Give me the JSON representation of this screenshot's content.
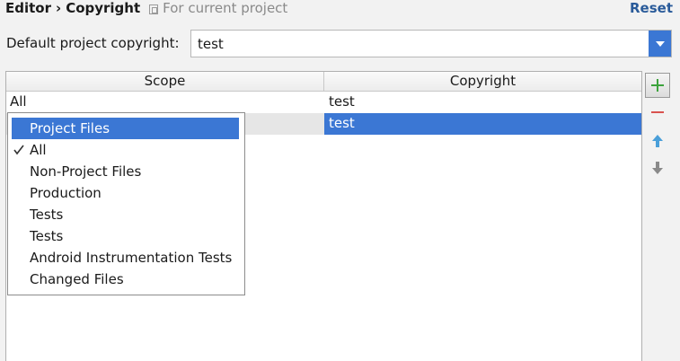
{
  "header": {
    "crumb_parent": "Editor",
    "crumb_separator": "›",
    "crumb_current": "Copyright",
    "scope_hint": "For current project",
    "scope_hint_icon": "copy-icon",
    "reset_label": "Reset"
  },
  "default_copyright": {
    "label": "Default project copyright:",
    "value": "test",
    "arrow_icon": "chevron-down-icon"
  },
  "table": {
    "columns": [
      "Scope",
      "Copyright"
    ],
    "rows": [
      {
        "scope": "All",
        "copyright": "test"
      },
      {
        "scope": "",
        "copyright": "test"
      }
    ]
  },
  "toolbar": {
    "add_icon": "plus-icon",
    "remove_icon": "minus-icon",
    "up_icon": "arrow-up-icon",
    "down_icon": "arrow-down-icon"
  },
  "scope_dropdown": {
    "items": [
      "Project Files",
      "All",
      "Non-Project Files",
      "Production",
      "Tests",
      "Tests",
      "Android Instrumentation Tests",
      "Changed Files"
    ],
    "highlighted_item": "Project Files",
    "checked_item": "All"
  },
  "colors": {
    "accent": "#3b77d4",
    "link": "#2a5b9a",
    "add_green": "#3ca33c",
    "remove_red": "#d9534f",
    "up_blue": "#4a9fd9",
    "down_gray": "#8a8a8a"
  }
}
